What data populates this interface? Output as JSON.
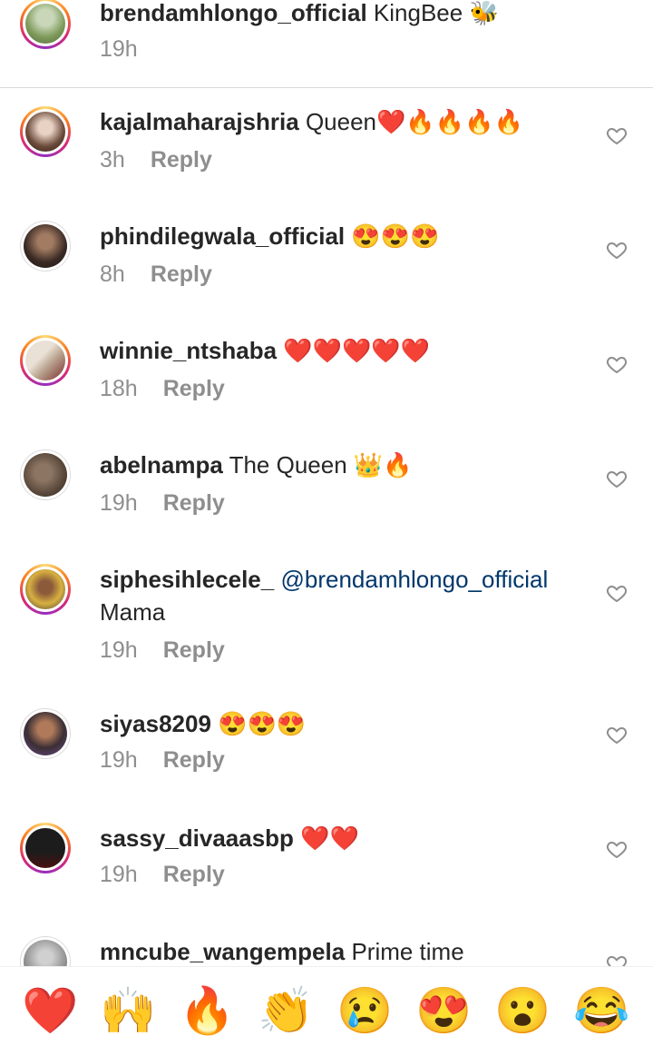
{
  "caption": {
    "username": "brendamhlongo_official",
    "text": "KingBee 🐝",
    "time": "19h",
    "avatar_color": "#7d9a5a"
  },
  "reply_label": "Reply",
  "comments": [
    {
      "username": "kajalmaharajshria",
      "text": "Queen❤️🔥🔥🔥🔥",
      "time": "3h",
      "avatar_color": "#6b4a3a"
    },
    {
      "username": "phindilegwala_official",
      "text": "😍😍😍",
      "time": "8h",
      "avatar_color": "#3a2a24"
    },
    {
      "username": "winnie_ntshaba",
      "text": "❤️❤️❤️❤️❤️",
      "time": "18h",
      "avatar_color": "#b9a48f"
    },
    {
      "username": "abelnampa",
      "text": "The Queen 👑🔥",
      "time": "19h",
      "avatar_color": "#5b4a3c"
    },
    {
      "username": "siphesihlecele_",
      "mention": "@brendamhlongo_official",
      "text": "Mama",
      "time": "19h",
      "avatar_color": "#d8b040"
    },
    {
      "username": "siyas8209",
      "text": "😍😍😍",
      "time": "19h",
      "avatar_color": "#3b2f35"
    },
    {
      "username": "sassy_divaaasbp",
      "text": "❤️❤️",
      "time": "19h",
      "avatar_color": "#1c1c1c"
    },
    {
      "username": "mncube_wangempela",
      "text": "Prime time",
      "avatar_color": "#9a9a9a"
    }
  ],
  "emoji_bar": [
    "❤️",
    "🙌",
    "🔥",
    "👏",
    "😢",
    "😍",
    "😮",
    "😂"
  ],
  "colors": {
    "link": "#00376b",
    "muted": "#8e8e8e",
    "text": "#262626"
  }
}
